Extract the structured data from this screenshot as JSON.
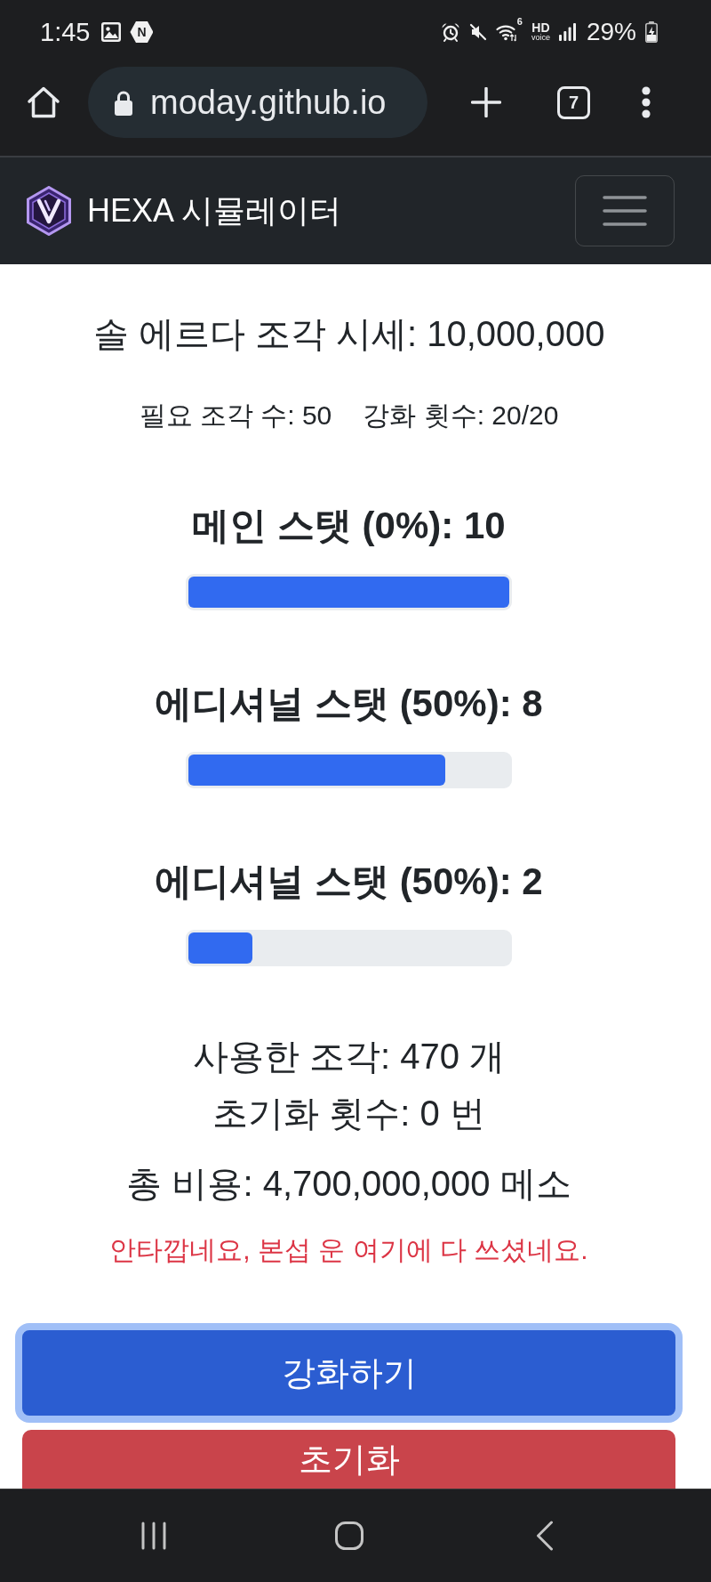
{
  "status_bar": {
    "time": "1:45",
    "notification_icons": [
      {
        "kind": "image"
      },
      {
        "kind": "letter",
        "letter": "N"
      }
    ],
    "wifi_label": "6",
    "hd_voice": {
      "top": "HD",
      "bottom": "voice"
    },
    "battery": "29%"
  },
  "browser": {
    "url": "moday.github.io",
    "tab_count": "7"
  },
  "navbar": {
    "brand": "HEXA 시뮬레이터"
  },
  "price": "솔 에르다 조각 시세: 10,000,000",
  "info": [
    "필요 조각 수: 50",
    "강화 횟수: 20/20"
  ],
  "stats": [
    {
      "label": "메인 스탯 (0%): 10",
      "level": 1
    },
    {
      "label": "에디셔널 스탯 (50%): 8",
      "level": 0.8
    },
    {
      "label": "에디셔널 스탯 (50%): 2",
      "level": 0.2
    }
  ],
  "summary": [
    "사용한 조각: 470 개",
    "초기화 횟수: 0 번"
  ],
  "total_cost": "총 비용: 4,700,000,000 메소",
  "message": "안타깝네요, 본섭 운 여기에 다 쓰셨네요.",
  "buttons": [
    {
      "label": "강화하기",
      "kind": "primary",
      "focused": true
    },
    {
      "label": "초기화",
      "kind": "danger",
      "focused": false
    }
  ]
}
